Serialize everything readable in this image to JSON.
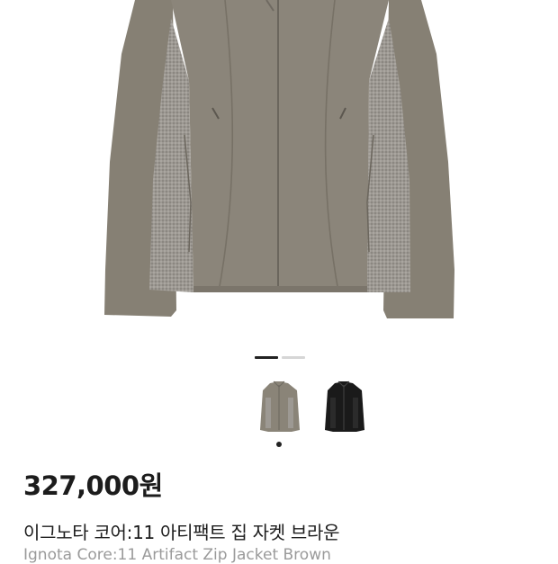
{
  "product": {
    "images": [
      {
        "icon": "jacket-gray-photo",
        "color": "#8a8478"
      },
      {
        "icon": "jacket-black-photo",
        "color": "#1a1a1a"
      }
    ],
    "pager": {
      "current": 1,
      "total": 2
    },
    "selected_thumbnail": 1,
    "price": "327,000원",
    "name_ko": "이그노타 코어:11 아티팩트 집 자켓 브라운",
    "name_en": "Ignota Core:11 Artifact Zip Jacket Brown"
  },
  "colors": {
    "jacket_main": "#8a8478",
    "jacket_knit": "#9a9690",
    "pager_active": "#222222",
    "pager_inactive": "#d6d6d6",
    "price_text": "#1c1c1c",
    "english_name_text": "#9a9a9a"
  }
}
